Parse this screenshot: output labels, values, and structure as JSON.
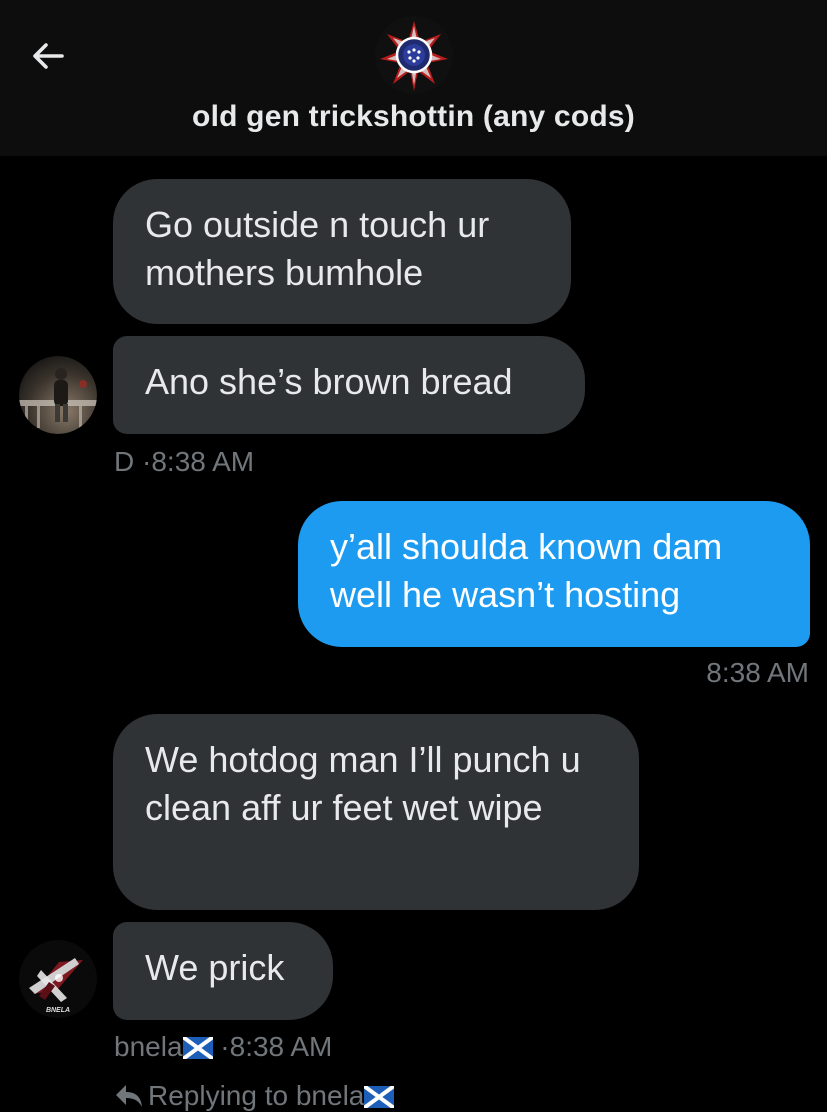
{
  "header": {
    "title": "old gen trickshottin (any cods)",
    "back_icon": "arrow-left-icon",
    "group_avatar_icon": "star-badge-icon"
  },
  "messages": [
    {
      "direction": "received",
      "text": "Go outside n touch ur mothers bumhole"
    },
    {
      "direction": "received",
      "text": "Ano she’s brown bread"
    },
    {
      "direction": "sent",
      "text": "y’all shoulda known dam well he wasn’t hosting"
    },
    {
      "direction": "received",
      "text": "We hotdog man I’ll punch u clean aff ur feet wet wipe"
    },
    {
      "direction": "received",
      "text": "We prick"
    }
  ],
  "meta": {
    "first": {
      "sender": "D",
      "separator": "·",
      "time": "8:38 AM"
    },
    "sent": {
      "time": "8:38 AM"
    },
    "second": {
      "sender": "bnela",
      "separator": "·",
      "time": "8:38 AM",
      "flag_icon": "scotland-flag-icon"
    }
  },
  "avatars": {
    "second_label": "BNELA"
  },
  "reply_hint": {
    "text": "Replying to bnela"
  },
  "colors": {
    "background": "#000000",
    "header": "#0d0d0d",
    "received_bubble": "#2f3336",
    "sent_bubble": "#1d9bf0",
    "meta_text": "#71767b",
    "primary_text": "#e7e9ea"
  }
}
